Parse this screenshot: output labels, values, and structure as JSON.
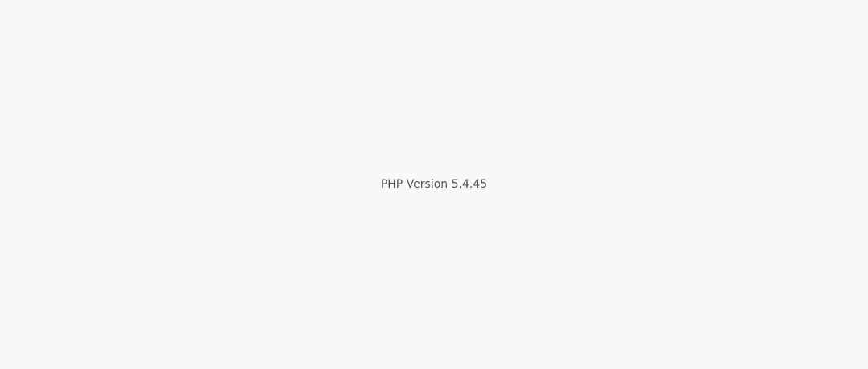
{
  "title": "PHP Version 5.4.45"
}
